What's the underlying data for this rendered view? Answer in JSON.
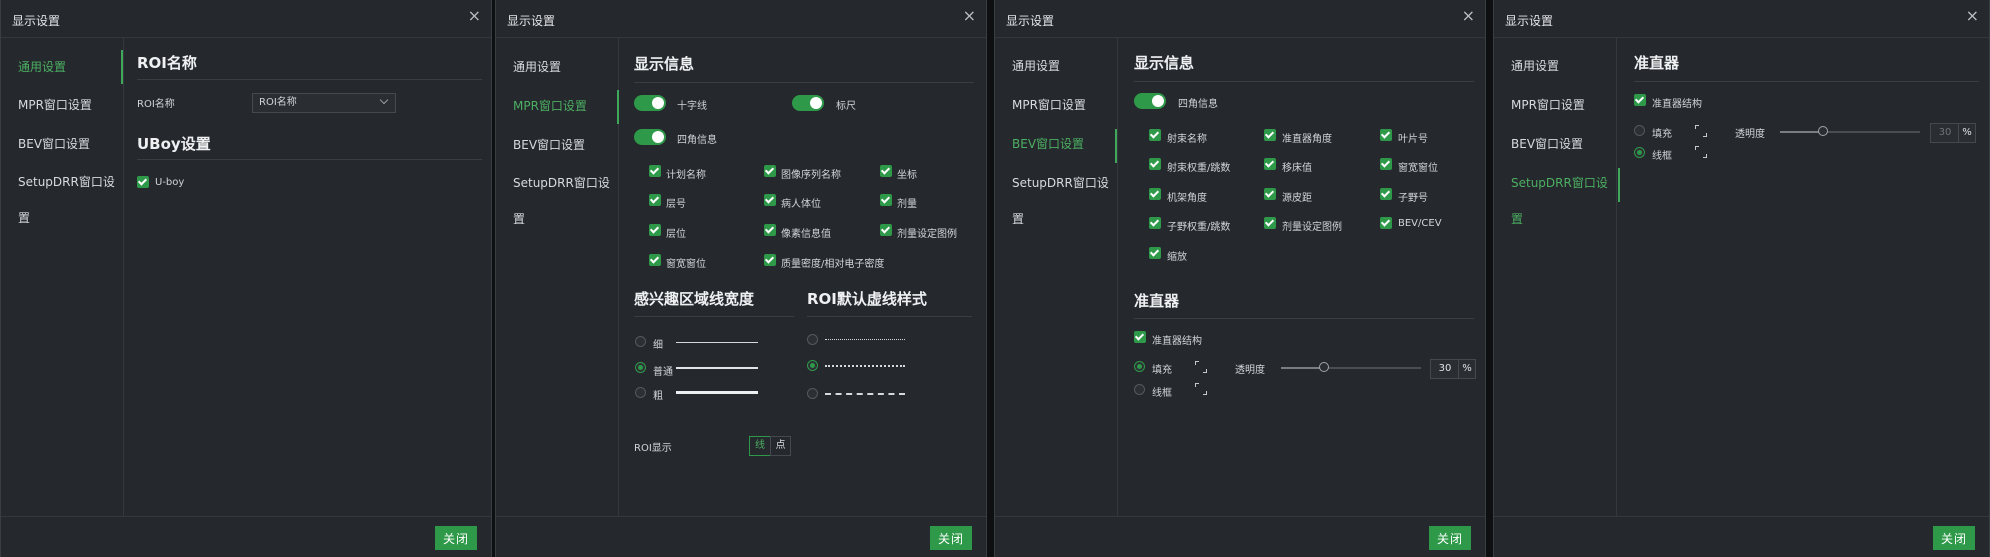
{
  "dialog_title": "显示设置",
  "close_label": "关闭",
  "nav": [
    "通用设置",
    "MPR窗口设置",
    "BEV窗口设置",
    "SetupDRR窗口设置"
  ],
  "accent_color": "#2e9a49",
  "panel1": {
    "active_nav": 0,
    "roi_heading": "ROI名称",
    "roi_field_label": "ROI名称",
    "roi_select_value": "ROI名称",
    "uboy_heading": "UBoy设置",
    "uboy_checkbox": "U-boy",
    "uboy_checked": true
  },
  "panel2": {
    "active_nav": 1,
    "display_heading": "显示信息",
    "toggle_crosshair": "十字线",
    "toggle_ruler": "标尺",
    "toggle_corner": "四角信息",
    "checks": [
      [
        "计划名称",
        "图像序列名称",
        "坐标"
      ],
      [
        "层号",
        "病人体位",
        "剂量"
      ],
      [
        "层位",
        "像素信息值",
        "剂量设定图例"
      ],
      [
        "窗宽窗位",
        "质量密度/相对电子密度"
      ]
    ],
    "width_heading": "感兴趣区域线宽度",
    "dash_heading": "ROI默认虚线样式",
    "width_options": [
      "细",
      "普通",
      "粗"
    ],
    "width_selected": "普通",
    "dash_selected_index": 1,
    "roi_display_label": "ROI显示",
    "roi_display_options": [
      "线",
      "点"
    ],
    "roi_display_selected": "线"
  },
  "panel3": {
    "active_nav": 2,
    "display_heading": "显示信息",
    "toggle_corner": "四角信息",
    "checks": [
      [
        "射束名称",
        "准直器角度",
        "叶片号"
      ],
      [
        "射束权重/跳数",
        "移床值",
        "窗宽窗位"
      ],
      [
        "机架角度",
        "源皮距",
        "子野号"
      ],
      [
        "子野权重/跳数",
        "剂量设定图例",
        "BEV/CEV"
      ],
      [
        "缩放"
      ]
    ],
    "collimator_heading": "准直器",
    "collimator_checkbox": "准直器结构",
    "fill_label": "填充",
    "wire_label": "线框",
    "fill_selected": true,
    "opacity_label": "透明度",
    "opacity_value": "30",
    "opacity_unit": "%"
  },
  "panel4": {
    "active_nav": 3,
    "collimator_heading": "准直器",
    "collimator_checkbox": "准直器结构",
    "fill_label": "填充",
    "wire_label": "线框",
    "wire_selected": true,
    "opacity_label": "透明度",
    "opacity_value": "30",
    "opacity_unit": "%"
  }
}
